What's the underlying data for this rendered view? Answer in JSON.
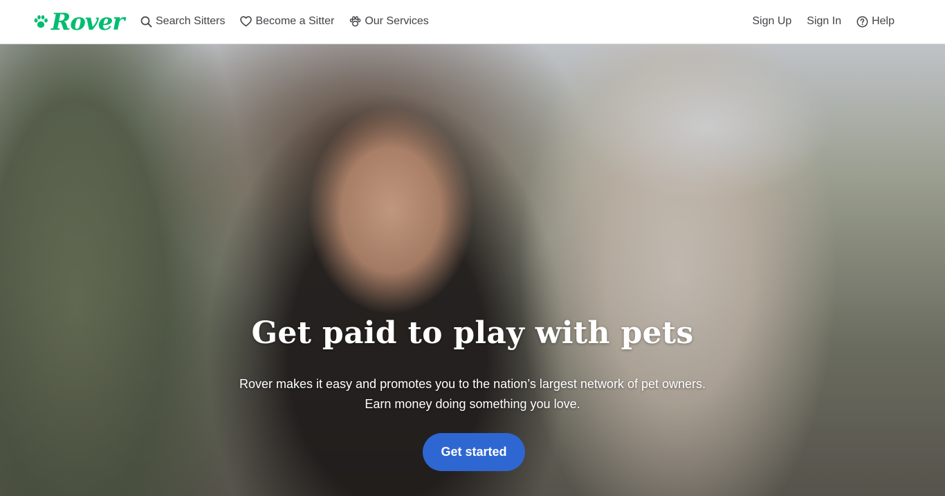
{
  "colors": {
    "brand_green": "#00bd70",
    "cta_blue": "#2e67d1",
    "nav_text": "#404347"
  },
  "header": {
    "logo_text": "Rover",
    "nav_left": [
      {
        "label": "Search Sitters",
        "icon": "search-icon"
      },
      {
        "label": "Become a Sitter",
        "icon": "heart-icon"
      },
      {
        "label": "Our Services",
        "icon": "paw-icon"
      }
    ],
    "nav_right": [
      {
        "label": "Sign Up"
      },
      {
        "label": "Sign In"
      },
      {
        "label": "Help",
        "icon": "help-circle-icon"
      }
    ]
  },
  "hero": {
    "title": "Get paid to play with pets",
    "subtitle_line1": "Rover makes it easy and promotes you to the nation’s largest network of pet owners.",
    "subtitle_line2": "Earn money doing something you love.",
    "cta_label": "Get started"
  }
}
